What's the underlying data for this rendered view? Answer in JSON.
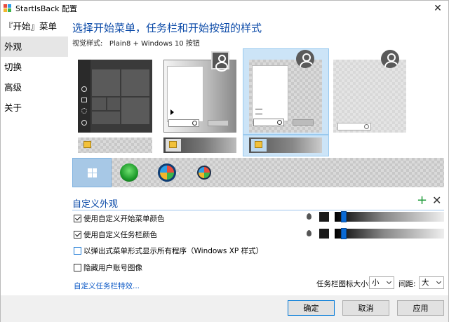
{
  "window": {
    "title": "StartIsBack 配置",
    "close_glyph": "✕"
  },
  "sidebar": {
    "items": [
      {
        "label": "『开始』菜单",
        "active": false
      },
      {
        "label": "外观",
        "active": true
      },
      {
        "label": "切换",
        "active": false
      },
      {
        "label": "高级",
        "active": false
      },
      {
        "label": "关于",
        "active": false
      }
    ]
  },
  "main": {
    "heading": "选择开始菜单，任务栏和开始按钮的样式",
    "visual_style_label": "视觉样式:",
    "visual_style_value": "Plain8 + Windows 10 按钮",
    "start_menu_styles": [
      {
        "name": "dark-tiles",
        "selected": false
      },
      {
        "name": "gradient-classic",
        "selected": false
      },
      {
        "name": "checker-translucent",
        "selected": true
      },
      {
        "name": "light-transparent",
        "selected": false
      }
    ],
    "taskbar_styles": [
      {
        "name": "plain-checker",
        "selected": false
      },
      {
        "name": "dark-gradient",
        "selected": false
      },
      {
        "name": "blue-dark-gradient",
        "selected": true
      }
    ],
    "start_buttons": [
      {
        "name": "windows-10-logo",
        "selected": true
      },
      {
        "name": "green-clover-orb",
        "selected": false
      },
      {
        "name": "windows-7-orb",
        "selected": false
      },
      {
        "name": "windows-vista-orb",
        "selected": false
      }
    ],
    "custom_section": {
      "title": "自定义外观",
      "add_glyph": "+",
      "remove_glyph": "✕",
      "options": [
        {
          "label": "使用自定义开始菜单颜色",
          "checked": true
        },
        {
          "label": "使用自定义任务栏颜色",
          "checked": true
        },
        {
          "label": "以弹出式菜单形式显示所有程序（Windows XP 样式）",
          "checked": false
        },
        {
          "label": "隐藏用户账号图像",
          "checked": false
        }
      ],
      "color_sliders": [
        {
          "target": "start-menu",
          "color": "#1a1a1a",
          "level_fraction": 0.06
        },
        {
          "target": "taskbar",
          "color": "#1a1a1a",
          "level_fraction": 0.06
        }
      ],
      "taskbar_effects_link": "自定义任务栏特效...",
      "taskbar_icon_size_label": "任务栏图标大小:",
      "taskbar_icon_size_value": "小",
      "spacing_label": "间距:",
      "spacing_value": "大"
    }
  },
  "footer": {
    "ok_label": "确定",
    "cancel_label": "取消",
    "apply_label": "应用"
  },
  "colors": {
    "accent_heading": "#0b4aa8",
    "selection_fill": "#cce4f7",
    "slider_thumb": "#0a6ad4",
    "link": "#0b58c6",
    "add_icon": "#1f9b3a"
  }
}
